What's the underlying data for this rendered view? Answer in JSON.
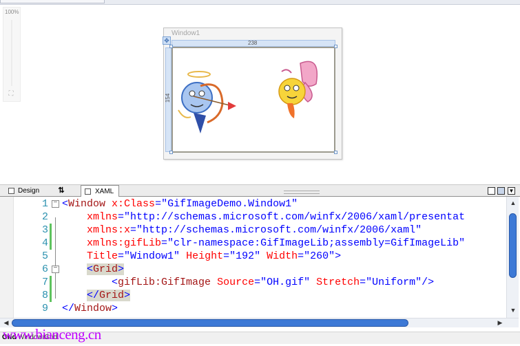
{
  "designer": {
    "zoom_label": "100%",
    "window_title": "Window1",
    "width_readout": "238",
    "height_readout": "154",
    "fit_icon": "fit-to-window-icon",
    "move_icon": "move-handle-icon"
  },
  "tabs": [
    {
      "label": "Design",
      "icon": "design-view-icon"
    },
    {
      "label": "⇅",
      "icon": "swap-panes-icon"
    },
    {
      "label": "XAML",
      "icon": "xaml-view-icon"
    }
  ],
  "editor": {
    "lines": [
      {
        "num": "1",
        "fold": "−",
        "changed": false,
        "tokens": [
          {
            "c": "t-bl",
            "t": "<"
          },
          {
            "c": "t-el",
            "t": "Window"
          },
          {
            "c": "",
            "t": " "
          },
          {
            "c": "t-at",
            "t": "x:Class"
          },
          {
            "c": "t-bl",
            "t": "=\"GifImageDemo.Window1\""
          }
        ]
      },
      {
        "num": "2",
        "fold": "",
        "changed": false,
        "tokens": [
          {
            "c": "",
            "t": "    "
          },
          {
            "c": "t-at",
            "t": "xmlns"
          },
          {
            "c": "t-bl",
            "t": "=\"http://schemas.microsoft.com/winfx/2006/xaml/presentat"
          }
        ]
      },
      {
        "num": "3",
        "fold": "",
        "changed": true,
        "tokens": [
          {
            "c": "",
            "t": "    "
          },
          {
            "c": "t-at",
            "t": "xmlns:x"
          },
          {
            "c": "t-bl",
            "t": "=\"http://schemas.microsoft.com/winfx/2006/xaml\""
          }
        ]
      },
      {
        "num": "4",
        "fold": "",
        "changed": true,
        "tokens": [
          {
            "c": "",
            "t": "    "
          },
          {
            "c": "t-at",
            "t": "xmlns:gifLib"
          },
          {
            "c": "t-bl",
            "t": "=\"clr-namespace:GifImageLib;assembly=GifImageLib\""
          }
        ]
      },
      {
        "num": "5",
        "fold": "",
        "changed": false,
        "tokens": [
          {
            "c": "",
            "t": "    "
          },
          {
            "c": "t-at",
            "t": "Title"
          },
          {
            "c": "t-bl",
            "t": "=\"Window1\" "
          },
          {
            "c": "t-at",
            "t": "Height"
          },
          {
            "c": "t-bl",
            "t": "=\"192\" "
          },
          {
            "c": "t-at",
            "t": "Width"
          },
          {
            "c": "t-bl",
            "t": "=\"260\">"
          }
        ]
      },
      {
        "num": "6",
        "fold": "−",
        "changed": false,
        "tokens": [
          {
            "c": "",
            "t": "    "
          },
          {
            "c": "t-bl hl",
            "t": "<"
          },
          {
            "c": "t-el hl",
            "t": "Grid"
          },
          {
            "c": "t-bl hl",
            "t": ">"
          }
        ]
      },
      {
        "num": "7",
        "fold": "",
        "changed": true,
        "tokens": [
          {
            "c": "",
            "t": "        "
          },
          {
            "c": "t-bl",
            "t": "<"
          },
          {
            "c": "t-el",
            "t": "gifLib:GifImage"
          },
          {
            "c": "",
            "t": " "
          },
          {
            "c": "t-at",
            "t": "Source"
          },
          {
            "c": "t-bl",
            "t": "=\"OH.gif\" "
          },
          {
            "c": "t-at",
            "t": "Stretch"
          },
          {
            "c": "t-bl",
            "t": "=\"Uniform\"/>"
          }
        ]
      },
      {
        "num": "8",
        "fold": "",
        "changed": true,
        "tokens": [
          {
            "c": "",
            "t": "    "
          },
          {
            "c": "t-bl hl",
            "t": "</"
          },
          {
            "c": "t-el hl",
            "t": "Grid"
          },
          {
            "c": "t-bl hl",
            "t": ">"
          }
        ]
      },
      {
        "num": "9",
        "fold": "",
        "changed": false,
        "tokens": [
          {
            "c": "t-bl",
            "t": "</"
          },
          {
            "c": "t-el",
            "t": "Window"
          },
          {
            "c": "t-bl",
            "t": ">"
          }
        ]
      }
    ]
  },
  "status": {
    "crumb_root": "Grid",
    "crumb_path": "Window/Grid"
  },
  "watermark": "www.bianceng.cn",
  "colors": {
    "accent": "#3d79d6",
    "change_bar": "#5ec35e",
    "line_number": "#2b91af",
    "watermark": "#c000ff"
  }
}
